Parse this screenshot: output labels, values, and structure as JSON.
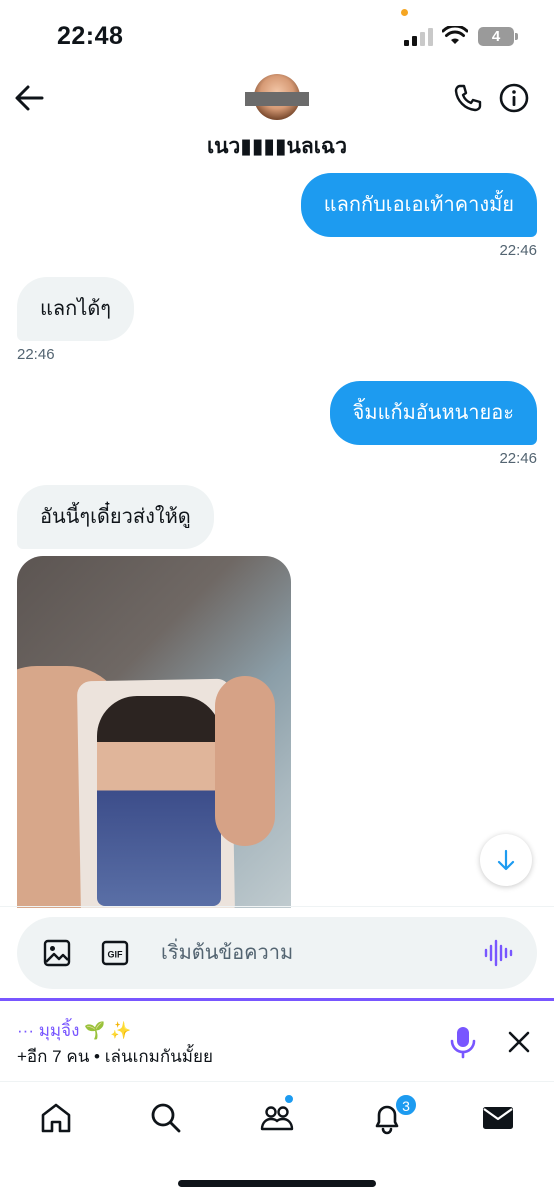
{
  "status_bar": {
    "time": "22:48",
    "battery_level": "4",
    "icons": [
      "signal-icon",
      "wifi-icon",
      "battery-icon"
    ]
  },
  "header": {
    "contact_name": "เนว▮▮▮▮นลเฉว",
    "back_icon": "arrow-left-icon",
    "call_icon": "phone-icon",
    "info_icon": "info-icon"
  },
  "messages": [
    {
      "direction": "out",
      "text": "แลกกับเอเอเท้าคางมั้ย",
      "time": "22:46"
    },
    {
      "direction": "in",
      "text": "แลกได้ๆ",
      "time": "22:46"
    },
    {
      "direction": "out",
      "text": "จิ้มแก้มอันหนายอะ",
      "time": "22:46"
    },
    {
      "direction": "in",
      "text": "อันนี้ๆเดี๋ยวส่งให้ดู",
      "time": ""
    }
  ],
  "attachment": {
    "type": "photo"
  },
  "composer": {
    "placeholder": "เริ่มต้นข้อความ",
    "gif_label": "GIF",
    "icons": [
      "image-icon",
      "gif-icon",
      "voice-wave-icon"
    ]
  },
  "space_bar": {
    "title": "··· มุมุจิ้ง 🌱 ✨",
    "subtitle": "+อีก 7 คน • เล่นเกมกันมั้ยย"
  },
  "bottom_nav": {
    "items": [
      "home-icon",
      "search-icon",
      "communities-icon",
      "notifications-icon",
      "messages-icon"
    ],
    "notification_count": "3"
  },
  "colors": {
    "accent": "#1d9bf0",
    "space_purple": "#7856ff",
    "incoming_bubble": "#eff3f4"
  }
}
